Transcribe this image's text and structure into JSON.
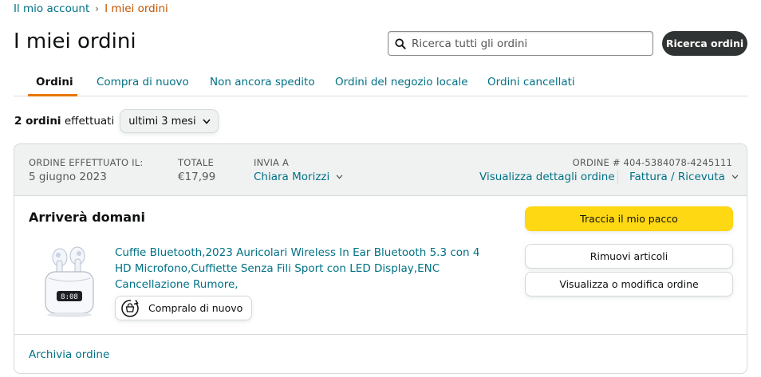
{
  "breadcrumb": {
    "account_label": "Il mio account",
    "separator": "›",
    "current_label": "I miei ordini"
  },
  "page": {
    "title": "I miei ordini"
  },
  "search": {
    "placeholder": "Ricerca tutti gli ordini",
    "value": "",
    "button_label": "Ricerca ordini",
    "icon": "search-icon"
  },
  "tabs": [
    {
      "label": "Ordini",
      "active": true
    },
    {
      "label": "Compra di nuovo",
      "active": false
    },
    {
      "label": "Non ancora spedito",
      "active": false
    },
    {
      "label": "Ordini del negozio locale",
      "active": false
    },
    {
      "label": "Ordini cancellati",
      "active": false
    }
  ],
  "summary": {
    "count_label": "2 ordini",
    "suffix": "effettuati",
    "filter_value": "ultimi 3 mesi",
    "filter_icon": "chevron-down-icon"
  },
  "order": {
    "placed_label": "ORDINE EFFETTUATO IL:",
    "placed_date": "5 giugno 2023",
    "total_label": "TOTALE",
    "total_value": "€17,99",
    "ship_to_label": "INVIA A",
    "ship_to_name": "Chiara Morizzi",
    "order_number_label": "ORDINE # 404-5384078-4245111",
    "details_link": "Visualizza dettagli ordine",
    "invoice_link": "Fattura / Ricevuta",
    "delivery_status": "Arriverà domani",
    "product_title": "Cuffie Bluetooth,2023 Auricolari Wireless In Ear Bluetooth 5.3 con 4 HD Microfono,Cuffiette Senza Fili Sport con LED Display,ENC Cancellazione Rumore,",
    "product_display_text": "8:08",
    "buy_again_label": "Compralo di nuovo",
    "buy_again_icon": "buy-again-icon",
    "track_button": "Traccia il mio pacco",
    "remove_button": "Rimuovi articoli",
    "modify_button": "Visualizza o modifica ordine",
    "archive_link": "Archivia ordine"
  },
  "colors": {
    "link": "#007185",
    "breadcrumb_current": "#c45500",
    "primary_button": "#ffd814",
    "dark_button": "#303333",
    "tab_underline": "#e77600",
    "header_bg": "#f0f2f2"
  }
}
